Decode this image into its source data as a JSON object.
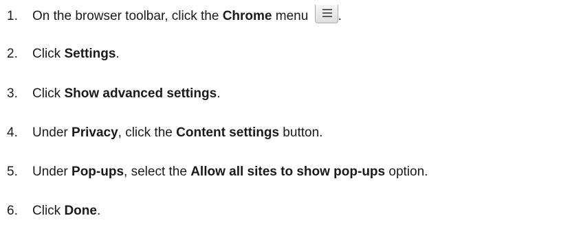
{
  "steps": [
    {
      "number": "1.",
      "before": "On the browser toolbar, click the ",
      "bold1": "Chrome",
      "after": " menu ",
      "end": "."
    },
    {
      "number": "2.",
      "before": "Click ",
      "bold1": "Settings",
      "end": "."
    },
    {
      "number": "3.",
      "before": "Click ",
      "bold1": "Show advanced settings",
      "end": "."
    },
    {
      "number": "4.",
      "before": "Under ",
      "bold1": "Privacy",
      "middle": ", click the ",
      "bold2": "Content settings",
      "end": " button."
    },
    {
      "number": "5.",
      "before": "Under ",
      "bold1": "Pop-ups",
      "middle": ", select the ",
      "bold2": "Allow all sites to show pop-ups",
      "end": " option."
    },
    {
      "number": "6.",
      "before": "Click ",
      "bold1": "Done",
      "end": "."
    }
  ],
  "icons": {
    "chrome_menu": "hamburger-menu-icon"
  }
}
